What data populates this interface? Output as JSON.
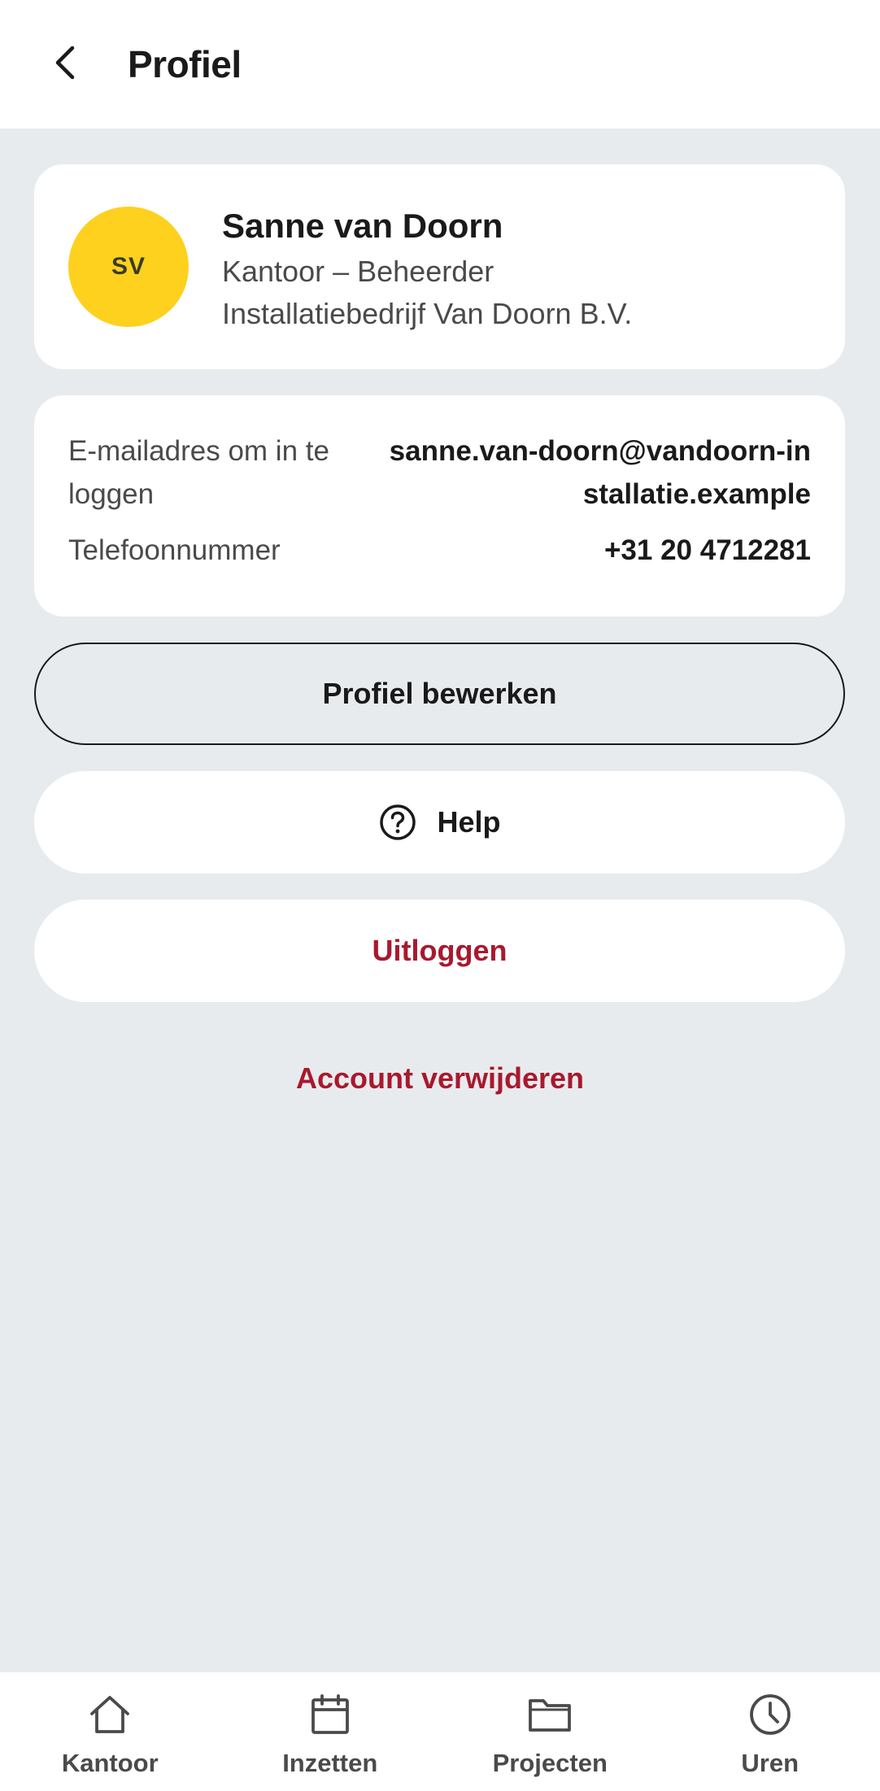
{
  "header": {
    "title": "Profiel",
    "back_icon": "chevron-left-icon"
  },
  "profile": {
    "initials": "SV",
    "name": "Sanne van Doorn",
    "role": "Kantoor – Beheerder",
    "company": "Installatiebedrijf Van Doorn B.V.",
    "avatar_color": "#fdd11e"
  },
  "info": {
    "email_label": "E-mailadres om in te loggen",
    "email_value": "sanne.van-doorn@vandoorn-installatie.example",
    "phone_label": "Telefoonnummer",
    "phone_value": "+31 20 4712281"
  },
  "actions": {
    "edit_label": "Profiel bewerken",
    "help_label": "Help",
    "help_icon": "help-circle-icon",
    "logout_label": "Uitloggen",
    "delete_label": "Account verwijderen"
  },
  "tabbar": {
    "items": [
      {
        "label": "Kantoor",
        "icon": "home-icon"
      },
      {
        "label": "Inzetten",
        "icon": "calendar-icon"
      },
      {
        "label": "Projecten",
        "icon": "folder-icon"
      },
      {
        "label": "Uren",
        "icon": "clock-icon"
      }
    ]
  },
  "colors": {
    "accent_danger": "#a8192e",
    "background": "#e8ebee",
    "surface": "#ffffff"
  }
}
